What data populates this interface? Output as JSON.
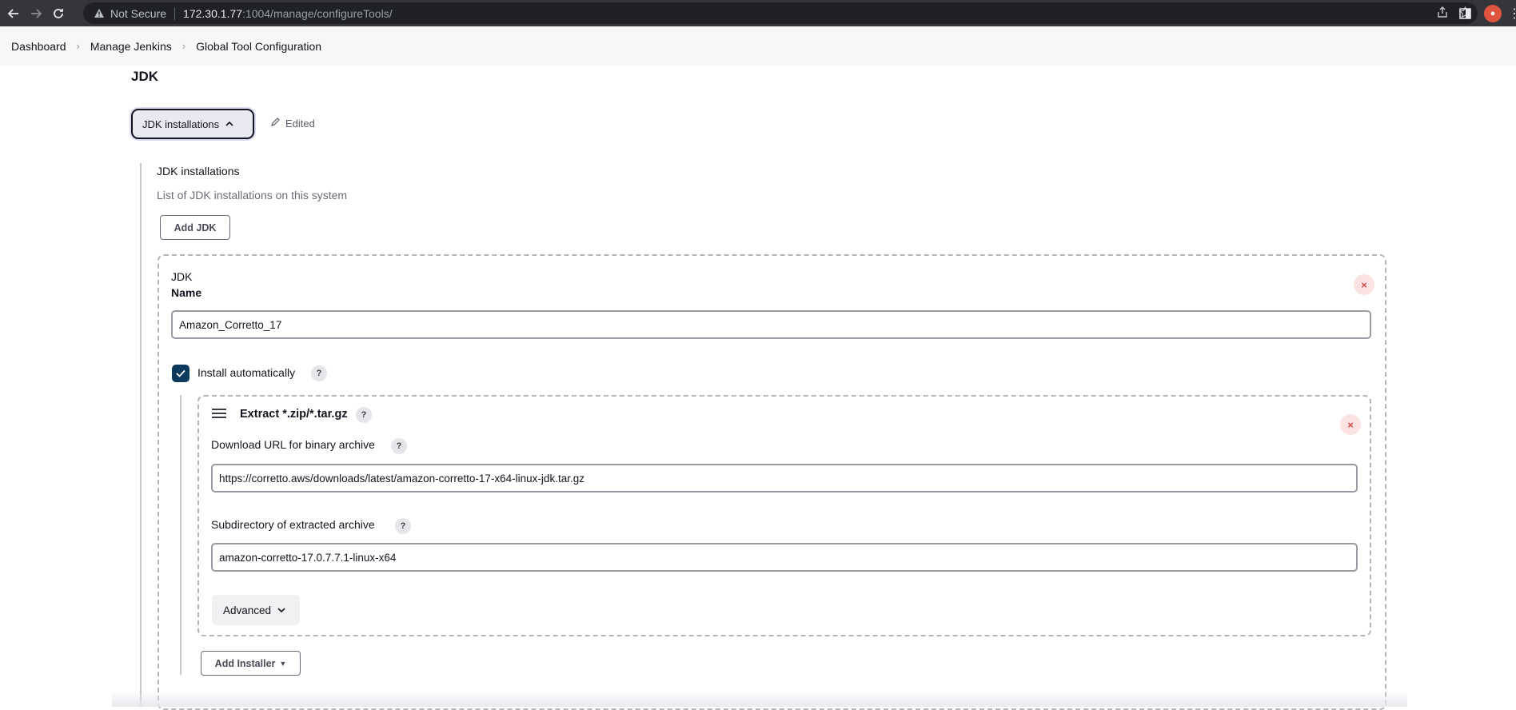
{
  "browser": {
    "security_label": "Not Secure",
    "url_host": "172.30.1.77",
    "url_rest": ":1004/manage/configureTools/"
  },
  "breadcrumb": {
    "items": [
      "Dashboard",
      "Manage Jenkins",
      "Global Tool Configuration"
    ]
  },
  "section": {
    "title": "JDK",
    "collapse_label": "JDK installations",
    "edited_label": "Edited"
  },
  "jdk_installations": {
    "label": "JDK installations",
    "description": "List of JDK installations on this system",
    "add_button": "Add JDK"
  },
  "jdk": {
    "title": "JDK",
    "name_label": "Name",
    "name_value": "Amazon_Corretto_17",
    "install_auto_label": "Install automatically",
    "install_auto_checked": true
  },
  "installer": {
    "title": "Extract *.zip/*.tar.gz",
    "url_label": "Download URL for binary archive",
    "url_value": "https://corretto.aws/downloads/latest/amazon-corretto-17-x64-linux-jdk.tar.gz",
    "subdir_label": "Subdirectory of extracted archive",
    "subdir_value": "amazon-corretto-17.0.7.7.1-linux-x64",
    "advanced_label": "Advanced"
  },
  "add_installer_label": "Add Installer",
  "icons": {
    "help": "?",
    "close": "×"
  },
  "colors": {
    "accent": "#0c3a5c",
    "danger": "#d24848",
    "chrome": "#35363a"
  }
}
